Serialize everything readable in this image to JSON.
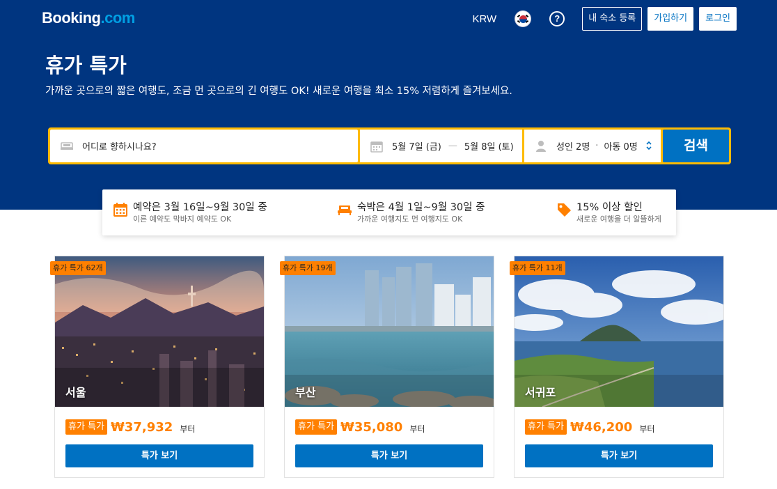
{
  "header": {
    "logo_text": "Booking",
    "logo_suffix": ".com",
    "currency": "KRW",
    "language_icon": "korea-flag-icon",
    "help_icon": "question-circle-icon",
    "list_property": "내 숙소 등록",
    "register": "가입하기",
    "sign_in": "로그인"
  },
  "hero": {
    "title": "휴가 특가",
    "subtitle": "가까운 곳으로의 짧은 여행도, 조금 먼 곳으로의 긴 여행도 OK! 새로운 여행을 최소 15% 저렴하게 즐겨보세요."
  },
  "search": {
    "destination_placeholder": "어디로 향하시나요?",
    "checkin": "5월 7일 (금)",
    "date_separator": "—",
    "checkout": "5월 8일 (토)",
    "adults": "성인 2명",
    "guest_separator": "·",
    "children": "아동 0명",
    "button": "검색"
  },
  "perks": [
    {
      "icon": "calendar-icon",
      "title": "예약은 3월 16일~9월 30일 중",
      "subtitle": "이른 예약도 막바지 예약도 OK"
    },
    {
      "icon": "bed-icon",
      "title": "숙박은 4월 1일~9월 30일 중",
      "subtitle": "가까운 여행지도 먼 여행지도 OK"
    },
    {
      "icon": "price-tag-icon",
      "title": "15% 이상 할인",
      "subtitle": "새로운 여행을 더 알뜰하게"
    }
  ],
  "cards": [
    {
      "badge": "휴가 특가 62개",
      "city": "서울",
      "deal_tag": "휴가 특가",
      "price": "₩37,932",
      "from": "부터",
      "button": "특가 보기"
    },
    {
      "badge": "휴가 특가 19개",
      "city": "부산",
      "deal_tag": "휴가 특가",
      "price": "₩35,080",
      "from": "부터",
      "button": "특가 보기"
    },
    {
      "badge": "휴가 특가 11개",
      "city": "서귀포",
      "deal_tag": "휴가 특가",
      "price": "₩46,200",
      "from": "부터",
      "button": "특가 보기"
    }
  ],
  "colors": {
    "brand_blue": "#003580",
    "action_blue": "#0071c2",
    "search_border": "#febb02",
    "deal_orange": "#ff8000"
  }
}
